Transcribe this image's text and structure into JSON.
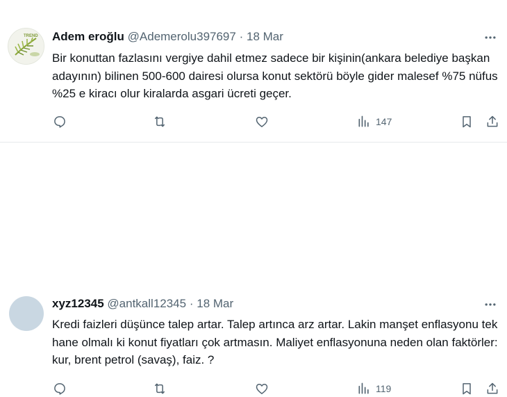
{
  "tweets": [
    {
      "name": "Adem eroğlu",
      "handle": "@Ademerolu397697",
      "sep": "·",
      "date": "18 Mar",
      "text": "Bir konuttan fazlasını vergiye dahil etmez sadece bir kişinin(ankara belediye başkan adayının) bilinen 500-600 dairesi olursa konut sektörü böyle gider malesef %75 nüfus %25 e kiracı olur kiralarda asgari ücreti geçer.",
      "views": "147",
      "avatar_text": "TREND"
    },
    {
      "name": "xyz12345",
      "handle": "@antkall12345",
      "sep": "·",
      "date": "18 Mar",
      "text": "Kredi faizleri düşünce talep artar. Talep artınca arz artar. Lakin manşet enflasyonu tek hane olmalı ki konut fiyatları çok artmasın. Maliyet enflasyonuna neden olan faktörler: kur, brent petrol (savaş), faiz. ?",
      "views": "119"
    }
  ],
  "colors": {
    "text": "#0f1419",
    "secondary": "#536471",
    "divider": "#e6e9ec",
    "avatar2": "#c9d7e2"
  },
  "icons": [
    "more-icon",
    "reply-icon",
    "retweet-icon",
    "like-icon",
    "views-icon",
    "bookmark-icon",
    "share-icon"
  ]
}
